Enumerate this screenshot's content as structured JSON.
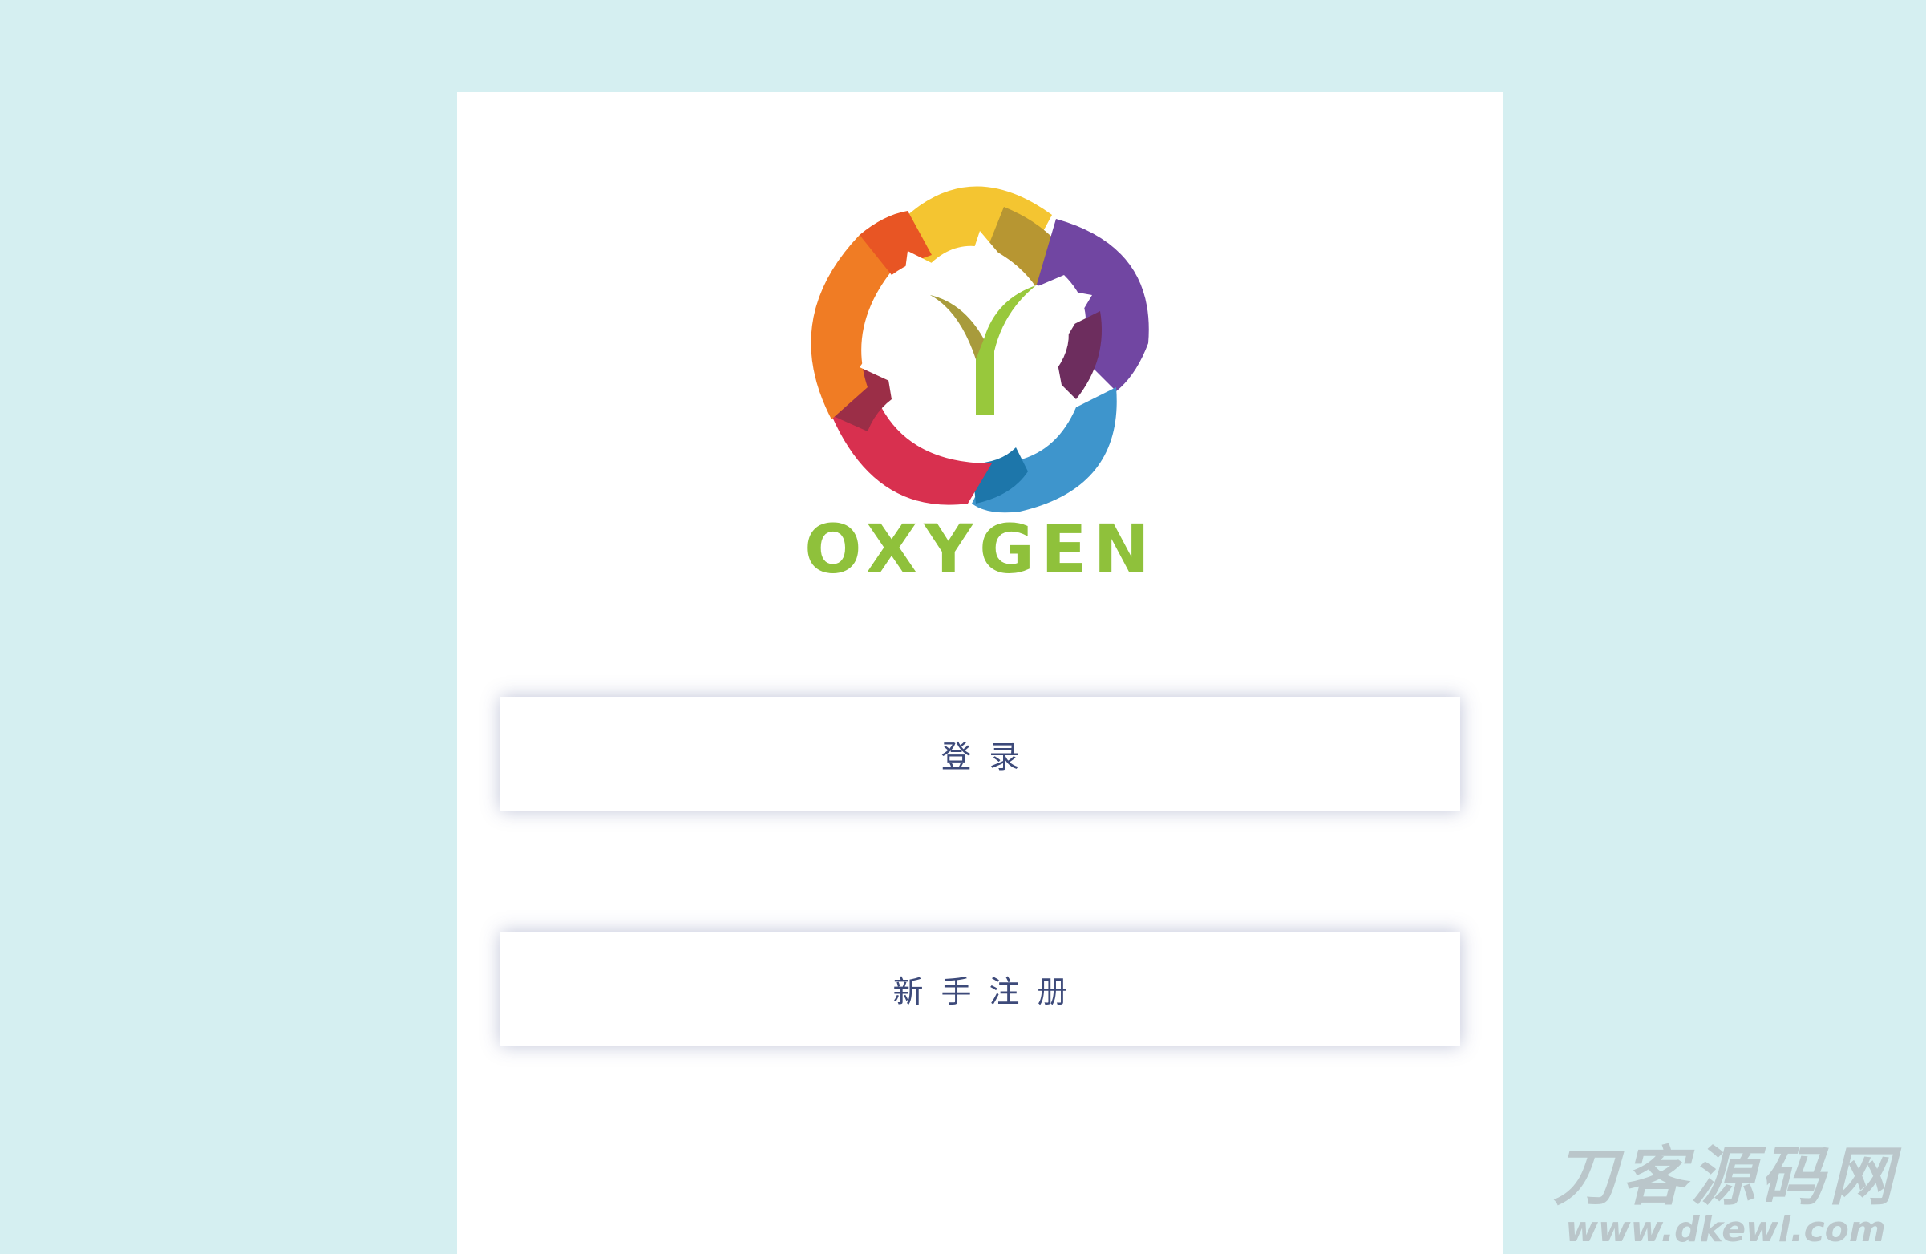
{
  "brand": {
    "name": "OXYGEN"
  },
  "buttons": {
    "login_label": "登录",
    "register_label": "新手注册"
  },
  "watermark": {
    "title": "刀客源码网",
    "url": "www.dkewl.com"
  },
  "colors": {
    "background": "#d5eff1",
    "panel": "#ffffff",
    "brand_green": "#8fc13b",
    "button_text": "#3d4a7a"
  },
  "icons": {
    "logo": "flower-y-logo-icon"
  }
}
